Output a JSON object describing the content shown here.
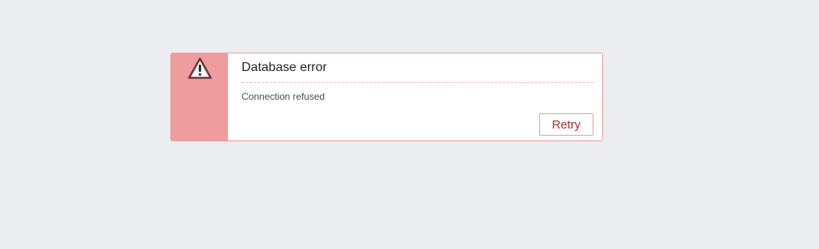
{
  "alert": {
    "icon": "warning-triangle-icon",
    "title": "Database error",
    "message": "Connection refused",
    "retry_label": "Retry"
  },
  "colors": {
    "background": "#ebedf0",
    "accent_side": "#ef9c9e",
    "border": "#e59ca0",
    "retry_text": "#b1272b"
  }
}
